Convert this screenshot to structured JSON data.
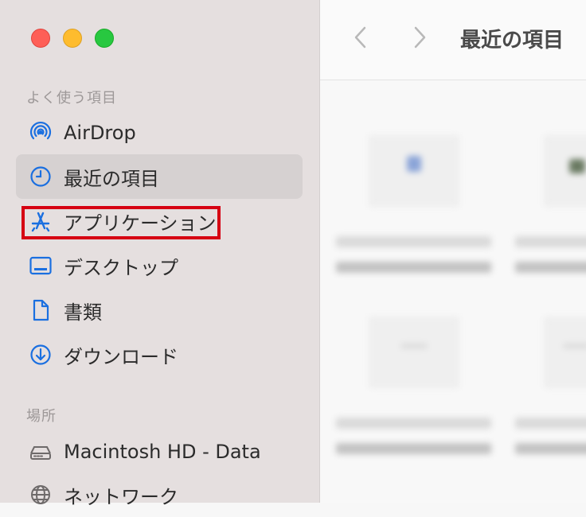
{
  "window": {
    "title": "最近の項目"
  },
  "sidebar": {
    "favorites_header": "よく使う項目",
    "favorites": [
      {
        "label": "AirDrop",
        "icon": "airdrop-icon"
      },
      {
        "label": "最近の項目",
        "icon": "clock-icon",
        "selected": true
      },
      {
        "label": "アプリケーション",
        "icon": "applications-icon",
        "highlighted": true
      },
      {
        "label": "デスクトップ",
        "icon": "desktop-icon"
      },
      {
        "label": "書類",
        "icon": "document-icon"
      },
      {
        "label": "ダウンロード",
        "icon": "download-icon"
      }
    ],
    "locations_header": "場所",
    "locations": [
      {
        "label": "Macintosh HD - Data",
        "icon": "disk-icon"
      },
      {
        "label": "ネットワーク",
        "icon": "network-icon"
      }
    ]
  },
  "colors": {
    "accent": "#1a6fe0",
    "highlight_border": "#d60012",
    "sidebar_bg": "#e5dfdf",
    "selected_bg": "#d6d1d1"
  }
}
